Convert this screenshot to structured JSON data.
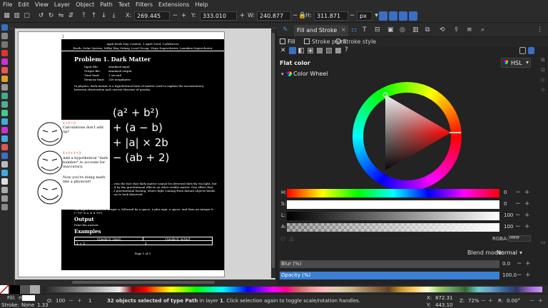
{
  "menu": [
    "File",
    "Edit",
    "View",
    "Layer",
    "Object",
    "Path",
    "Text",
    "Filters",
    "Extensions",
    "Help"
  ],
  "toolbar": {
    "x_label": "X:",
    "x_value": "269.445",
    "y_label": "Y:",
    "y_value": "333.010",
    "w_label": "W:",
    "w_value": "240.877",
    "h_label": "H:",
    "h_value": "311.871",
    "unit": "px"
  },
  "document": {
    "header_line1": "April Fools Day Contest, 1 April 2024, Codeforces",
    "header_line2": "Earth, Solar System, Milky Way Galaxy, Local Group, Virgo Supercluster, Laniakea Supercluster",
    "problem_title": "Problem 1. Dark Matter",
    "meta": [
      {
        "k": "Input file:",
        "v": "standard input"
      },
      {
        "k": "Output file:",
        "v": "standard output"
      },
      {
        "k": "Time limit:",
        "v": "1 second"
      },
      {
        "k": "Memory limit:",
        "v": "256 megabytes"
      }
    ],
    "intro": "In physics, dark matter is a hypothetical form of matter used to explain the inconsistency between observation and current theories of gravity.",
    "math_lines": [
      "(a² + b²)",
      "+ (a − b)",
      "+ |a| × 2b",
      "− (ab + 2)"
    ],
    "body_text1": "...rom the fact that dark matter cannot be detected directly via light, but",
    "body_text2": "...d by the gravitational effects on other visible matter. One effect that",
    "body_text3": "...l gravitational lensing, where light coming from distant objects bends",
    "body_text4": "...on to look distorted.",
    "input_text": "The input contains an integer a, followed by a space, a plus sign, a space, and then an integer b (−10⁹ ≤ a, b ≤ 10⁹).",
    "output_title": "Output",
    "output_text": "Print the answer.",
    "examples_title": "Examples",
    "table_head": [
      "standard input",
      "standard output"
    ],
    "table_row": [
      "1 + 1",
      "3"
    ],
    "page_footer": "Page 1 of 1"
  },
  "memes": [
    {
      "eq": "1+1=3",
      "text": "Calculations don't add up?"
    },
    {
      "eq": "1+1+1=3",
      "text": "Add a hypothetical \"dark number\" to account for inaccuracy."
    },
    {
      "eq": "",
      "text": "Now you're doing math like a physicist!"
    }
  ],
  "panel": {
    "tab_title": "Fill and Stroke",
    "subtabs": [
      "Fill",
      "Stroke paint",
      "Stroke style"
    ],
    "fill_type": "Flat color",
    "color_mode": "HSL",
    "wheel_label": "Color Wheel",
    "sliders": [
      {
        "label": "H:",
        "value": "0"
      },
      {
        "label": "S:",
        "value": "0"
      },
      {
        "label": "L:",
        "value": "100"
      },
      {
        "label": "A:",
        "value": "100"
      }
    ],
    "rgba_label": "RGBA:",
    "rgba_value": "ffffffff",
    "blend_label": "Blend mode:",
    "blend_value": "Normal",
    "blur_label": "Blur (%)",
    "blur_value": "0.0",
    "opacity_label": "Opacity (%)",
    "opacity_value": "100.0"
  },
  "status": {
    "fill_label": "Fill:",
    "fill_value": "m",
    "stroke_label": "Stroke:",
    "stroke_value": "None",
    "stroke_width": "1.33",
    "opacity_o": "O:",
    "opacity_v": "100",
    "layer_value": "1",
    "message_pre": "32 objects selected of type ",
    "message_type": "Path",
    "message_mid": " in layer ",
    "message_layer": "1",
    "message_post": ". Click selection again to toggle scale/rotation handles.",
    "x_label": "X:",
    "x_value": "872.31",
    "y_label": "Y:",
    "y_value": "443.10",
    "zoom_label": "Z:",
    "zoom_value": "72%",
    "rot_label": "R:",
    "rot_value": "0.00°"
  },
  "colors": {
    "accent": "#3a6fc4"
  }
}
